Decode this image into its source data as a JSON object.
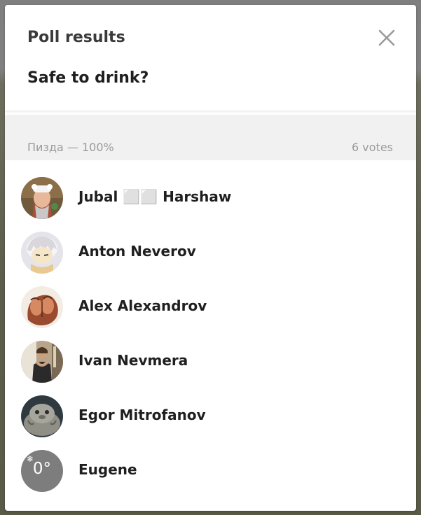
{
  "dialog": {
    "title": "Poll results",
    "close_icon": "close-icon"
  },
  "poll": {
    "question": "Safe to drink?",
    "answers": [
      {
        "label": "Пизда — 100%",
        "percent": 100,
        "votes_text": "6 votes",
        "voters": [
          {
            "name": "Jubal ⬜⬜ Harshaw",
            "avatar": "photo-avatar"
          },
          {
            "name": "Anton Neverov",
            "avatar": "photo-avatar"
          },
          {
            "name": "Alex Alexandrov",
            "avatar": "photo-avatar"
          },
          {
            "name": "Ivan Nevmera",
            "avatar": "photo-avatar"
          },
          {
            "name": "Egor Mitrofanov",
            "avatar": "photo-avatar"
          },
          {
            "name": "Eugene",
            "avatar": "temperature-avatar",
            "avatar_text": "0°",
            "avatar_icon": "snowflake-icon"
          }
        ]
      }
    ]
  },
  "colors": {
    "dialog_bg": "#ffffff",
    "answer_header_bg": "#f1f1f1",
    "muted_text": "#9a9a9a",
    "name_text": "#1f1f1f",
    "placeholder_avatar_bg": "#7d7d7d"
  }
}
